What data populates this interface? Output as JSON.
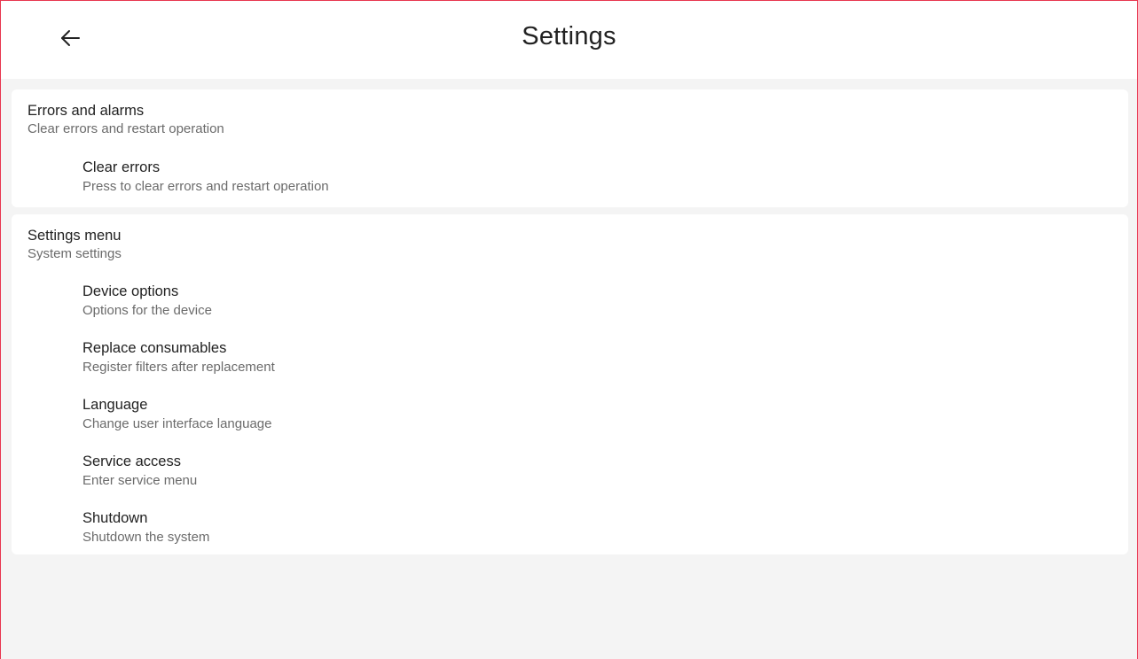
{
  "header": {
    "title": "Settings",
    "back_icon": "arrow-left-icon"
  },
  "sections": [
    {
      "title": "Errors and alarms",
      "subtitle": "Clear errors and restart operation",
      "items": [
        {
          "title": "Clear errors",
          "subtitle": "Press to clear errors and restart operation"
        }
      ]
    },
    {
      "title": "Settings menu",
      "subtitle": "System settings",
      "items": [
        {
          "title": "Device options",
          "subtitle": "Options for the device"
        },
        {
          "title": "Replace consumables",
          "subtitle": "Register filters after replacement"
        },
        {
          "title": "Language",
          "subtitle": "Change user interface language"
        },
        {
          "title": "Service access",
          "subtitle": "Enter service menu"
        },
        {
          "title": "Shutdown",
          "subtitle": "Shutdown the system"
        }
      ]
    }
  ],
  "colors": {
    "frame_border": "#e8364f",
    "background": "#f4f4f4",
    "card": "#ffffff",
    "primary_text": "#222222",
    "secondary_text": "#6b6b6b"
  }
}
